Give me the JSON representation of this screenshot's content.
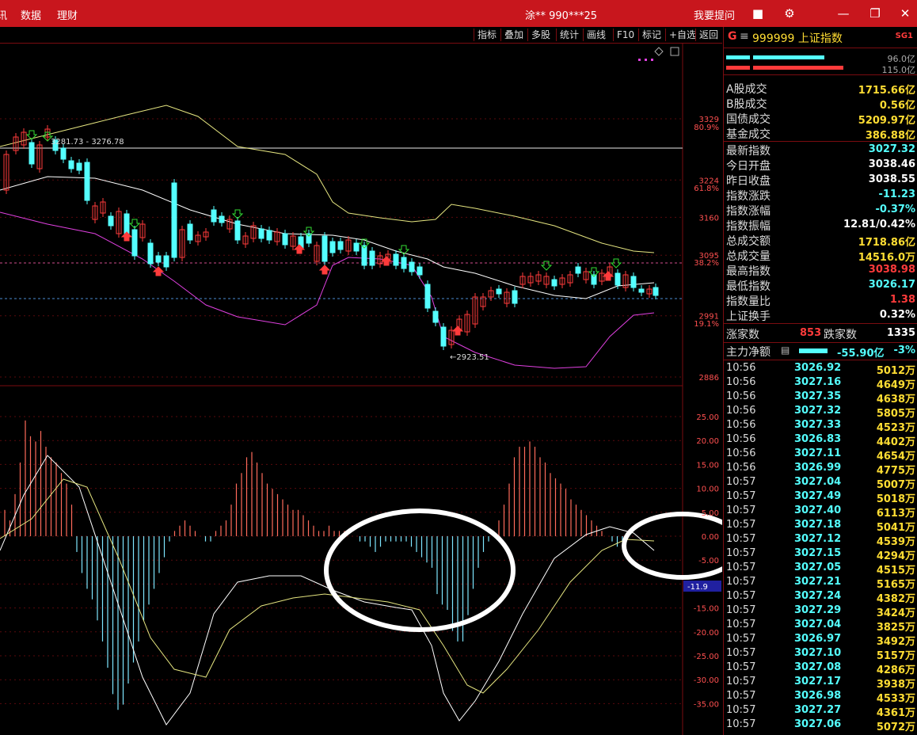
{
  "titlebar": {
    "menu": [
      "讯",
      "数据",
      "理财"
    ],
    "window_title": "涂** 990***25",
    "help": "我要提问"
  },
  "toolbar": {
    "buttons": [
      "指标",
      "叠加",
      "多股",
      "统计",
      "画线",
      "F10",
      "标记",
      "+自选",
      "返回"
    ]
  },
  "colors": {
    "up": "#ff3b3b",
    "down": "#54ffff",
    "neutral": "#ffffff",
    "value_yellow": "#ffdd33",
    "accent": "#c8161d"
  },
  "chart": {
    "price_labels": {
      "right_axis": [
        "3329",
        "3224",
        "3160",
        "3095",
        "2991",
        "2886"
      ],
      "fib_pct": [
        "80.9%",
        "61.8%",
        "38.2%",
        "19.1%"
      ],
      "annot_high": "3281.73 - 3276.78",
      "annot_low": "2923.51"
    },
    "macd_axis": [
      "25.00",
      "20.00",
      "15.00",
      "10.00",
      "5.00",
      "0.00",
      "-5.00",
      "-10.00",
      "-15.00",
      "-20.00",
      "-25.00",
      "-30.00",
      "-35.00"
    ],
    "macd_current": "-11.9"
  },
  "panel": {
    "header": {
      "g": "G",
      "code": "999999 上证指数",
      "badge": "SG1"
    },
    "bars": {
      "buy_label": "96.0亿",
      "sell_label": "115.0亿"
    },
    "turnover": [
      {
        "k": "A股成交",
        "v": "1715.66亿",
        "c": "#ffdd33"
      },
      {
        "k": "B股成交",
        "v": "0.56亿",
        "c": "#ffdd33"
      },
      {
        "k": "国债成交",
        "v": "5209.97亿",
        "c": "#ffdd33"
      },
      {
        "k": "基金成交",
        "v": "386.88亿",
        "c": "#ffdd33"
      }
    ],
    "quote": [
      {
        "k": "最新指数",
        "v": "3027.32",
        "c": "#54ffff"
      },
      {
        "k": "今日开盘",
        "v": "3038.46",
        "c": "#ffffff"
      },
      {
        "k": "昨日收盘",
        "v": "3038.55",
        "c": "#ffffff"
      },
      {
        "k": "指数涨跌",
        "v": "-11.23",
        "c": "#54ffff"
      },
      {
        "k": "指数涨幅",
        "v": "-0.37%",
        "c": "#54ffff"
      },
      {
        "k": "指数振幅",
        "v": "12.81/0.42%",
        "c": "#ffffff"
      },
      {
        "k": "总成交额",
        "v": "1718.86亿",
        "c": "#ffdd33"
      },
      {
        "k": "总成交量",
        "v": "14516.0万",
        "c": "#ffdd33"
      },
      {
        "k": "最高指数",
        "v": "3038.98",
        "c": "#ff3b3b"
      },
      {
        "k": "最低指数",
        "v": "3026.17",
        "c": "#54ffff"
      },
      {
        "k": "指数量比",
        "v": "1.38",
        "c": "#ff3b3b"
      },
      {
        "k": "上证换手",
        "v": "0.32%",
        "c": "#ffffff"
      }
    ],
    "updown": {
      "up_label": "涨家数",
      "up_value": "853",
      "down_label": "跌家数",
      "down_value": "1335"
    },
    "flow": {
      "label": "主力净额",
      "value": "-55.90亿",
      "pct": "-3%"
    },
    "ticks": [
      {
        "t": "10:56",
        "p": "3026.92",
        "v": "5012万"
      },
      {
        "t": "10:56",
        "p": "3027.16",
        "v": "4649万"
      },
      {
        "t": "10:56",
        "p": "3027.35",
        "v": "4638万"
      },
      {
        "t": "10:56",
        "p": "3027.32",
        "v": "5805万"
      },
      {
        "t": "10:56",
        "p": "3027.33",
        "v": "4523万"
      },
      {
        "t": "10:56",
        "p": "3026.83",
        "v": "4402万"
      },
      {
        "t": "10:56",
        "p": "3027.11",
        "v": "4654万"
      },
      {
        "t": "10:56",
        "p": "3026.99",
        "v": "4775万"
      },
      {
        "t": "10:57",
        "p": "3027.04",
        "v": "5007万"
      },
      {
        "t": "10:57",
        "p": "3027.49",
        "v": "5018万"
      },
      {
        "t": "10:57",
        "p": "3027.40",
        "v": "6113万"
      },
      {
        "t": "10:57",
        "p": "3027.18",
        "v": "5041万"
      },
      {
        "t": "10:57",
        "p": "3027.12",
        "v": "4539万"
      },
      {
        "t": "10:57",
        "p": "3027.15",
        "v": "4294万"
      },
      {
        "t": "10:57",
        "p": "3027.05",
        "v": "4515万"
      },
      {
        "t": "10:57",
        "p": "3027.21",
        "v": "5165万"
      },
      {
        "t": "10:57",
        "p": "3027.24",
        "v": "4382万"
      },
      {
        "t": "10:57",
        "p": "3027.29",
        "v": "3424万"
      },
      {
        "t": "10:57",
        "p": "3027.04",
        "v": "3825万"
      },
      {
        "t": "10:57",
        "p": "3026.97",
        "v": "3492万"
      },
      {
        "t": "10:57",
        "p": "3027.10",
        "v": "5157万"
      },
      {
        "t": "10:57",
        "p": "3027.08",
        "v": "4286万"
      },
      {
        "t": "10:57",
        "p": "3027.17",
        "v": "3938万"
      },
      {
        "t": "10:57",
        "p": "3026.98",
        "v": "4533万"
      },
      {
        "t": "10:57",
        "p": "3027.27",
        "v": "4361万"
      },
      {
        "t": "10:57",
        "p": "3027.06",
        "v": "5072万"
      }
    ]
  }
}
